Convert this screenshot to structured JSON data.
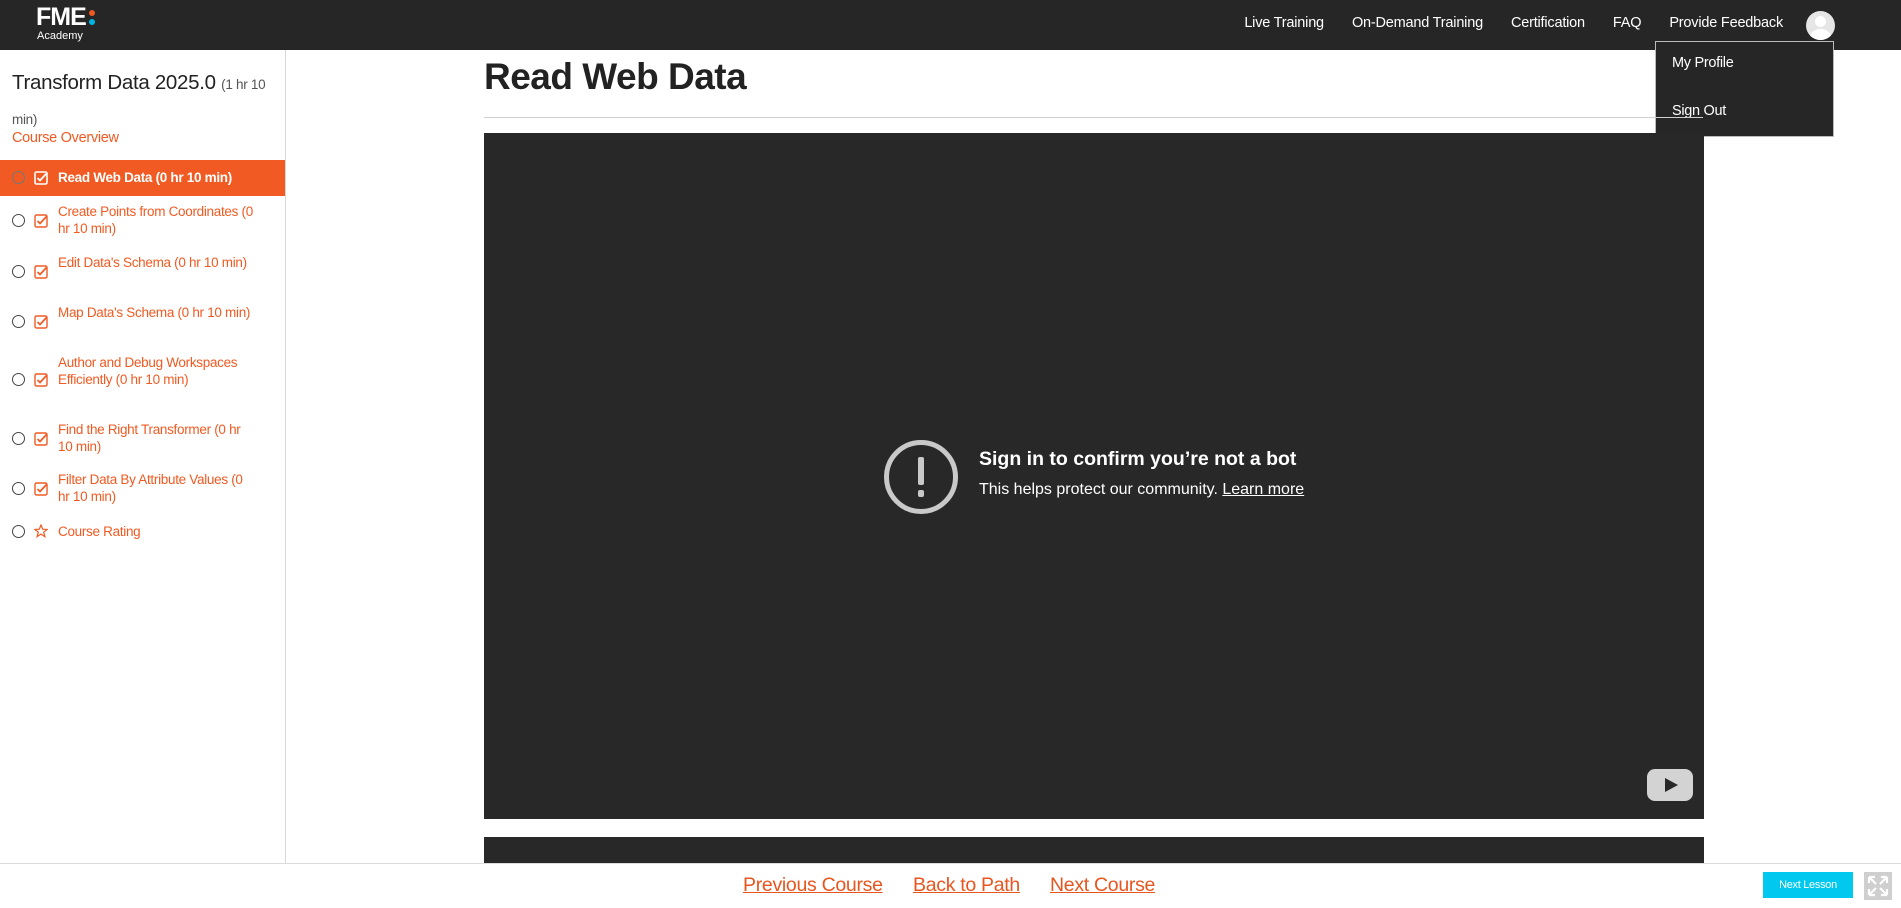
{
  "header": {
    "logo_main": "FME",
    "logo_sub": "Academy",
    "logo_dot_colors": [
      "#f05a22",
      "#00b5e2"
    ],
    "nav": [
      "Live Training",
      "On-Demand Training",
      "Certification",
      "FAQ",
      "Provide Feedback"
    ],
    "user_menu": [
      "My Profile",
      "Sign Out"
    ]
  },
  "sidebar": {
    "course_title": "Transform Data 2025.0",
    "course_duration": "(1 hr 10 min)",
    "overview_link": "Course Overview",
    "lessons": [
      {
        "label": "Read Web Data   (0 hr 10 min)",
        "icon": "checkbox-icon"
      },
      {
        "label": "Create Points from Coordinates   (0 hr 10 min)",
        "icon": "checkbox-icon"
      },
      {
        "label": "Edit Data's Schema   (0 hr 10 min)",
        "icon": "checkbox-icon"
      },
      {
        "label": "Map Data's Schema   (0 hr 10 min)",
        "icon": "checkbox-icon"
      },
      {
        "label": "Author and Debug Workspaces Efficiently   (0 hr 10 min)",
        "icon": "checkbox-icon"
      },
      {
        "label": "Find the Right Transformer   (0 hr 10 min)",
        "icon": "checkbox-icon"
      },
      {
        "label": "Filter Data By Attribute Values   (0 hr 10 min)",
        "icon": "checkbox-icon"
      },
      {
        "label": "Course Rating",
        "icon": "star-icon"
      }
    ]
  },
  "main": {
    "title": "Read Web Data",
    "video": {
      "heading": "Sign in to confirm you’re not a bot",
      "message": "This helps protect our community.",
      "link": "Learn more"
    }
  },
  "footer": {
    "previous": "Previous Course",
    "back": "Back to Path",
    "next": "Next Course",
    "next_lesson": "Next Lesson"
  },
  "colors": {
    "accent": "#f05a22",
    "topbar": "#262626",
    "next_lesson_button": "#00c8ee"
  }
}
